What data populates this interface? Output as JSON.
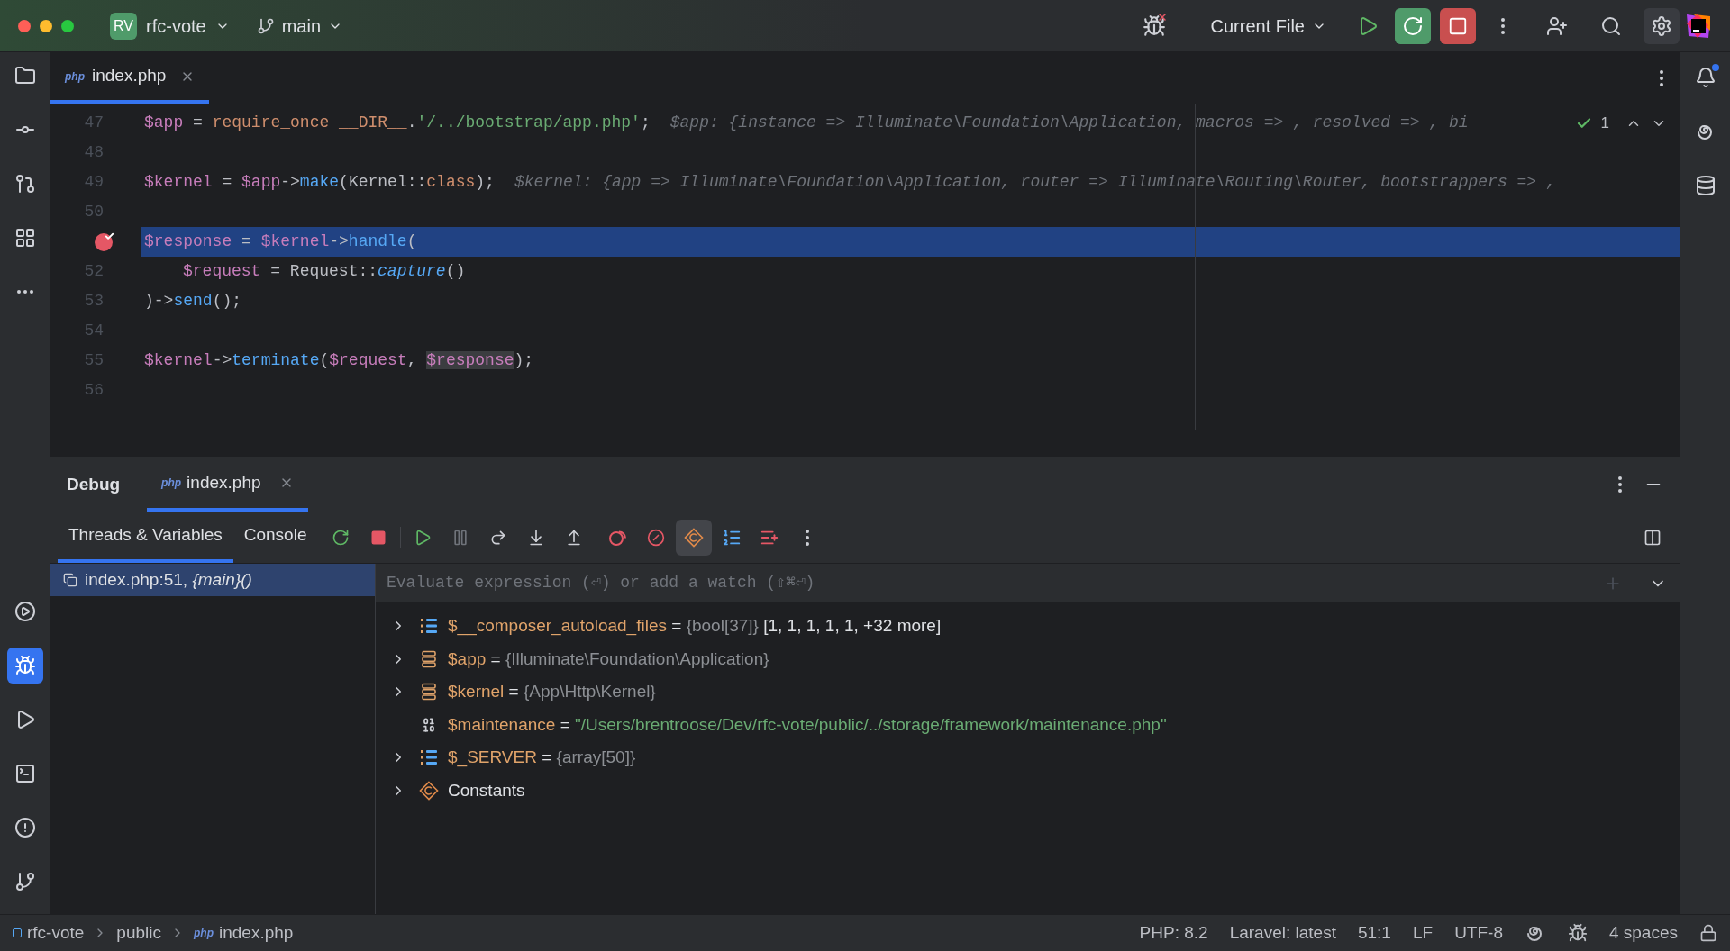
{
  "title_bar": {
    "project_initials": "RV",
    "project": "rfc-vote",
    "branch": "main",
    "run_config": "Current File"
  },
  "left_toolbar": {
    "top": [
      {
        "selected": false
      },
      {
        "selected": false
      },
      {
        "selected": false
      },
      {
        "selected": false
      },
      {
        "selected": false
      }
    ],
    "bottom": [
      {
        "selected": false
      },
      {
        "selected": true
      },
      {
        "selected": false
      },
      {
        "selected": false
      },
      {
        "selected": false
      },
      {
        "selected": false
      }
    ]
  },
  "editor": {
    "tabs": [
      {
        "icon_label": "php",
        "label": "index.php",
        "selected": true
      }
    ],
    "inspection": {
      "count": "1"
    },
    "lines": [
      {
        "number": "47",
        "breakpoint": false,
        "current": false,
        "tokens": [
          {
            "kind": "var",
            "text": "$app"
          },
          {
            "kind": "plain",
            "text": " = "
          },
          {
            "kind": "keyword",
            "text": "require_once __DIR__"
          },
          {
            "kind": "plain",
            "text": "."
          },
          {
            "kind": "string",
            "text": "'/../bootstrap/app.php'"
          },
          {
            "kind": "plain",
            "text": ";"
          }
        ],
        "hint": "$app: {instance => Illuminate\\Foundation\\Application, macros => , resolved => , bi"
      },
      {
        "number": "48",
        "breakpoint": false,
        "current": false
      },
      {
        "number": "49",
        "breakpoint": false,
        "current": false,
        "tokens": [
          {
            "kind": "var",
            "text": "$kernel"
          },
          {
            "kind": "plain",
            "text": " = "
          },
          {
            "kind": "var",
            "text": "$app"
          },
          {
            "kind": "plain",
            "text": "->"
          },
          {
            "kind": "fn",
            "text": "make"
          },
          {
            "kind": "plain",
            "text": "(Kernel::"
          },
          {
            "kind": "keyword",
            "text": "class"
          },
          {
            "kind": "plain",
            "text": ");"
          }
        ],
        "hint": "$kernel: {app => Illuminate\\Foundation\\Application, router => Illuminate\\Routing\\Router, bootstrappers => ,"
      },
      {
        "number": "50",
        "breakpoint": false,
        "current": false
      },
      {
        "breakpoint": true,
        "current": true,
        "tokens": [
          {
            "kind": "var",
            "text": "$response"
          },
          {
            "kind": "plain",
            "text": " = "
          },
          {
            "kind": "var",
            "text": "$kernel"
          },
          {
            "kind": "plain",
            "text": "->"
          },
          {
            "kind": "fn",
            "text": "handle"
          },
          {
            "kind": "plain",
            "text": "("
          }
        ]
      },
      {
        "number": "52",
        "breakpoint": false,
        "current": false,
        "indented": true,
        "tokens": [
          {
            "kind": "var",
            "text": "$request"
          },
          {
            "kind": "plain",
            "text": " = Request::"
          },
          {
            "kind": "static",
            "text": "capture"
          },
          {
            "kind": "plain",
            "text": "()"
          }
        ]
      },
      {
        "number": "53",
        "breakpoint": false,
        "current": false,
        "tokens": [
          {
            "kind": "plain",
            "text": ")->"
          },
          {
            "kind": "fn",
            "text": "send"
          },
          {
            "kind": "plain",
            "text": "();"
          }
        ]
      },
      {
        "number": "54",
        "breakpoint": false,
        "current": false
      },
      {
        "number": "55",
        "breakpoint": false,
        "current": false,
        "tokens": [
          {
            "kind": "var",
            "text": "$kernel"
          },
          {
            "kind": "plain",
            "text": "->"
          },
          {
            "kind": "fn",
            "text": "terminate"
          },
          {
            "kind": "plain",
            "text": "("
          },
          {
            "kind": "var",
            "text": "$request"
          },
          {
            "kind": "plain",
            "text": ", "
          },
          {
            "kind": "var_marked",
            "text": "$response"
          },
          {
            "kind": "plain",
            "text": ");"
          }
        ]
      },
      {
        "number": "56",
        "breakpoint": false,
        "current": false
      }
    ]
  },
  "debug": {
    "title": "Debug",
    "tabs": [
      {
        "icon_label": "php",
        "label": "index.php",
        "selected": true
      }
    ],
    "subtabs": [
      {
        "label": "Threads & Variables",
        "selected": true
      },
      {
        "label": "Console",
        "selected": false
      }
    ],
    "constants_toggle_on": true,
    "frames": [
      {
        "file": "index.php:51, ",
        "func": "{main}()",
        "selected": true
      }
    ],
    "evaluate_placeholder": "Evaluate expression (⏎) or add a watch (⇧⌘⏎)",
    "variables": [
      {
        "kind": "array",
        "expandable": true,
        "name": "$__composer_autoload_files",
        "assign": "=",
        "type": "{bool[37]}",
        "value": "[1, 1, 1, 1, 1, +32 more]"
      },
      {
        "kind": "object",
        "expandable": true,
        "name": "$app",
        "assign": "=",
        "type": "{Illuminate\\Foundation\\Application}"
      },
      {
        "kind": "object",
        "expandable": true,
        "name": "$kernel",
        "assign": "=",
        "type": "{App\\Http\\Kernel}"
      },
      {
        "kind": "string",
        "expandable": false,
        "name": "$maintenance",
        "assign": "=",
        "string": "\"/Users/brentroose/Dev/rfc-vote/public/../storage/framework/maintenance.php\""
      },
      {
        "kind": "array",
        "expandable": true,
        "name": "$_SERVER",
        "assign": "=",
        "type": "{array[50]}"
      },
      {
        "kind": "constants",
        "expandable": true,
        "name": "Constants"
      }
    ]
  },
  "status_bar": {
    "breadcrumbs": [
      {
        "label": "rfc-vote"
      },
      {
        "label": "public"
      },
      {
        "icon_label": "php",
        "label": "index.php"
      }
    ],
    "php": "PHP: 8.2",
    "laravel": "Laravel: latest",
    "position": "51:1",
    "line_ending": "LF",
    "encoding": "UTF-8",
    "indent": "4 spaces"
  }
}
